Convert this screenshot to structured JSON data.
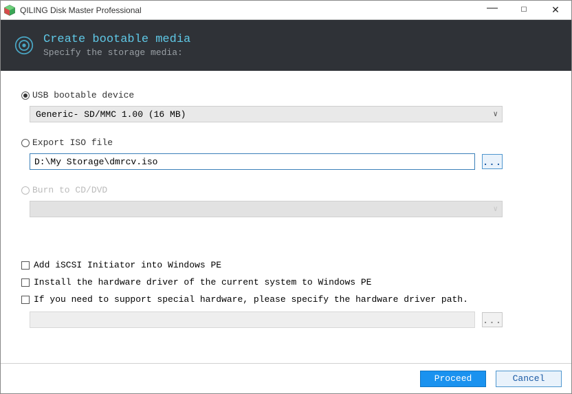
{
  "window": {
    "title": "QILING Disk Master Professional"
  },
  "header": {
    "title": "Create bootable media",
    "subtitle": "Specify the storage media:"
  },
  "options": {
    "usb": {
      "label": "USB bootable device",
      "selected_value": "Generic- SD/MMC 1.00 (16 MB)"
    },
    "iso": {
      "label": "Export ISO file",
      "path": "D:\\My Storage\\dmrcv.iso"
    },
    "burn": {
      "label": "Burn to CD/DVD"
    }
  },
  "checkboxes": {
    "iscsi": "Add iSCSI Initiator into Windows PE",
    "hw_driver": "Install the hardware driver of the current system to Windows PE",
    "special_hw": "If you need to support special hardware, please specify the hardware driver path."
  },
  "buttons": {
    "proceed": "Proceed",
    "cancel": "Cancel",
    "browse": "..."
  }
}
